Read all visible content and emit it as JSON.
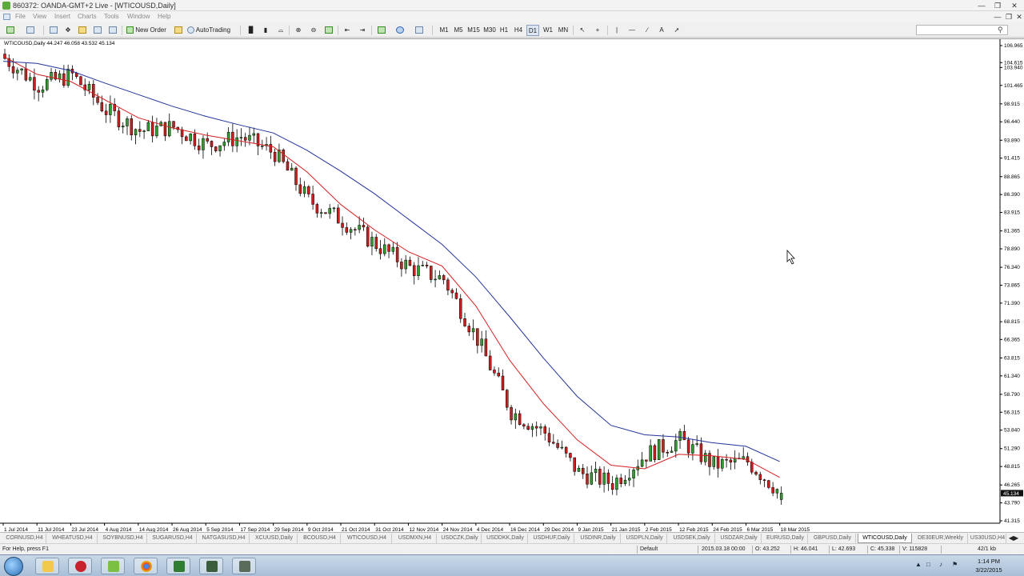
{
  "window": {
    "title": "860372: OANDA-GMT+2 Live - [WTICOUSD,Daily]"
  },
  "menu": [
    "File",
    "View",
    "Insert",
    "Charts",
    "Tools",
    "Window",
    "Help"
  ],
  "toolbar": {
    "new_order": "New Order",
    "autotrading": "AutoTrading",
    "timeframes": [
      "M1",
      "M5",
      "M15",
      "M30",
      "H1",
      "H4",
      "D1",
      "W1",
      "MN"
    ],
    "active_timeframe": "D1"
  },
  "chart": {
    "label": "WTICOUSD,Daily  44.247 46.058 43.532 45.134",
    "current_price": "45.134",
    "price_ticks": [
      "106.965",
      "104.615",
      "103.940",
      "101.465",
      "98.915",
      "96.440",
      "93.890",
      "91.415",
      "88.865",
      "86.390",
      "83.915",
      "81.365",
      "78.890",
      "76.340",
      "73.865",
      "71.390",
      "68.815",
      "66.365",
      "63.815",
      "61.340",
      "58.790",
      "56.315",
      "53.840",
      "51.290",
      "48.815",
      "46.265",
      "43.790",
      "41.315"
    ],
    "date_ticks": [
      "1 Jul 2014",
      "11 Jul 2014",
      "23 Jul 2014",
      "4 Aug 2014",
      "14 Aug 2014",
      "26 Aug 2014",
      "5 Sep 2014",
      "17 Sep 2014",
      "29 Sep 2014",
      "9 Oct 2014",
      "21 Oct 2014",
      "31 Oct 2014",
      "12 Nov 2014",
      "24 Nov 2014",
      "4 Dec 2014",
      "16 Dec 2014",
      "29 Dec 2014",
      "9 Jan 2015",
      "21 Jan 2015",
      "2 Feb 2015",
      "12 Feb 2015",
      "24 Feb 2015",
      "6 Mar 2015",
      "18 Mar 2015"
    ],
    "colors": {
      "bull": "#2e9e2e",
      "bear": "#cc1f1f",
      "ma_fast": "#d22020",
      "ma_slow": "#23339a",
      "price_tag": "#111111"
    }
  },
  "chart_data": {
    "type": "candlestick",
    "symbol": "WTICOUSD",
    "timeframe": "Daily",
    "ylim": [
      41.315,
      106.965
    ],
    "x": [
      "1 Jul 2014",
      "11 Jul 2014",
      "23 Jul 2014",
      "4 Aug 2014",
      "14 Aug 2014",
      "26 Aug 2014",
      "5 Sep 2014",
      "17 Sep 2014",
      "29 Sep 2014",
      "9 Oct 2014",
      "21 Oct 2014",
      "31 Oct 2014",
      "12 Nov 2014",
      "24 Nov 2014",
      "4 Dec 2014",
      "16 Dec 2014",
      "29 Dec 2014",
      "9 Jan 2015",
      "21 Jan 2015",
      "2 Feb 2015",
      "12 Feb 2015",
      "24 Feb 2015",
      "6 Mar 2015",
      "18 Mar 2015"
    ],
    "close_approx": [
      105.2,
      101.5,
      102.9,
      98.0,
      95.2,
      95.7,
      93.2,
      94.4,
      92.1,
      85.6,
      82.8,
      79.5,
      76.3,
      74.7,
      66.4,
      56.4,
      53.5,
      48.0,
      46.5,
      50.5,
      52.5,
      49.0,
      49.5,
      45.1
    ],
    "series": [
      {
        "name": "MA fast",
        "values": [
          105.5,
          103.0,
          102.0,
          99.5,
          97.0,
          95.6,
          94.6,
          93.8,
          93.0,
          89.5,
          85.0,
          81.5,
          78.5,
          76.5,
          71.0,
          63.5,
          57.5,
          52.5,
          49.0,
          48.5,
          50.5,
          50.3,
          49.8,
          47.3
        ]
      },
      {
        "name": "MA slow",
        "values": [
          104.8,
          104.5,
          103.5,
          101.8,
          100.2,
          98.6,
          97.2,
          96.0,
          94.9,
          92.5,
          89.6,
          86.5,
          83.0,
          79.5,
          75.0,
          69.5,
          63.8,
          58.5,
          54.5,
          53.2,
          52.9,
          52.1,
          51.6,
          49.5
        ]
      }
    ],
    "last": {
      "open": 44.247,
      "high": 46.058,
      "low": 43.532,
      "close": 45.134
    }
  },
  "tabs": [
    "CORNUSD,H4",
    "WHEATUSD,H4",
    "SOYBNUSD,H4",
    "SUGARUSD,H4",
    "NATGASUSD,H4",
    "XCUUSD,Daily",
    "BCOUSD,H4",
    "WTICOUSD,H4",
    "USDMXN,H4",
    "USDCZK,Daily",
    "USDDKK,Daily",
    "USDHUF,Daily",
    "USDINR,Daily",
    "USDPLN,Daily",
    "USDSEK,Daily",
    "USDZAR,Daily",
    "EURUSD,Daily",
    "GBPUSD,Daily",
    "WTICOUSD,Daily",
    "DE30EUR,Weekly",
    "US30USD,H4"
  ],
  "active_tab": "WTICOUSD,Daily",
  "status": {
    "help": "For Help, press F1",
    "profile": "Default",
    "datetime": "2015.03.18 00:00",
    "open": "O: 43.252",
    "high": "H: 46.041",
    "low": "L: 42.693",
    "close": "C: 45.338",
    "volume": "V: 115828",
    "traffic": "42/1 kb"
  },
  "taskbar": {
    "time": "1:14 PM",
    "date": "3/22/2015"
  }
}
